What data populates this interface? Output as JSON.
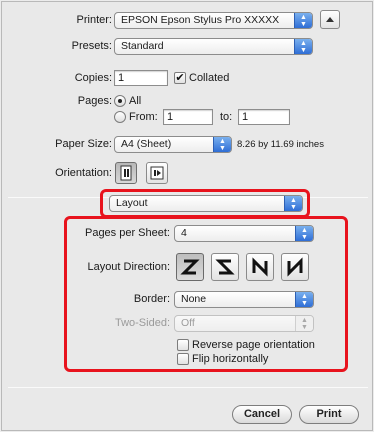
{
  "printer": {
    "label": "Printer:",
    "value": "EPSON Epson Stylus Pro XXXXX"
  },
  "presets": {
    "label": "Presets:",
    "value": "Standard"
  },
  "copies": {
    "label": "Copies:",
    "value": "1",
    "collated_label": "Collated",
    "collated": true
  },
  "pages": {
    "label": "Pages:",
    "all_label": "All",
    "from_label": "From:",
    "from_value": "1",
    "to_label": "to:",
    "to_value": "1"
  },
  "paper_size": {
    "label": "Paper Size:",
    "value": "A4 (Sheet)",
    "dimensions": "8.26 by 11.69 inches"
  },
  "orientation": {
    "label": "Orientation:",
    "options": [
      "portrait-icon",
      "landscape-icon"
    ],
    "selected": "portrait"
  },
  "panel": {
    "value": "Layout"
  },
  "layout": {
    "pages_per_sheet_label": "Pages per Sheet:",
    "pages_per_sheet": "4",
    "direction_label": "Layout Direction:",
    "directions": [
      "Z-order-icon",
      "reverse-S-order-icon",
      "N-reverse-order-icon",
      "N-order-icon"
    ],
    "selected_direction": 0,
    "border_label": "Border:",
    "border_value": "None",
    "two_sided_label": "Two-Sided:",
    "two_sided_value": "Off",
    "reverse_label": "Reverse page orientation",
    "flip_label": "Flip horizontally"
  },
  "buttons": {
    "cancel": "Cancel",
    "print": "Print"
  },
  "colors": {
    "highlight": "#e8131d",
    "popup_accent": "#2f6ed6"
  }
}
